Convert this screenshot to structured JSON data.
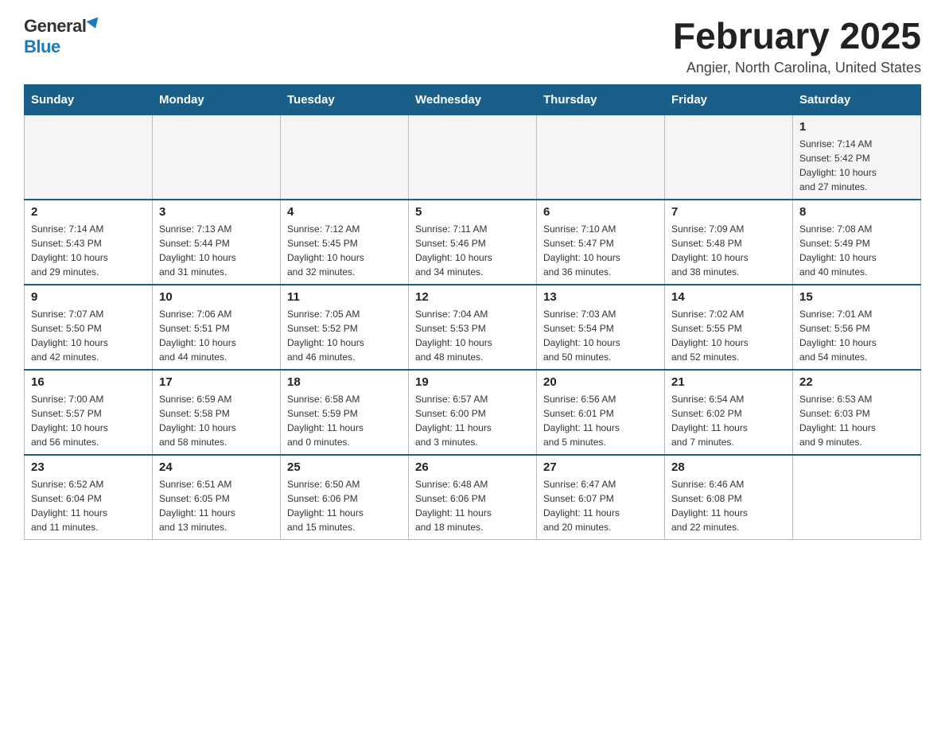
{
  "logo": {
    "general": "General",
    "blue": "Blue"
  },
  "title": "February 2025",
  "subtitle": "Angier, North Carolina, United States",
  "days_of_week": [
    "Sunday",
    "Monday",
    "Tuesday",
    "Wednesday",
    "Thursday",
    "Friday",
    "Saturday"
  ],
  "weeks": [
    {
      "days": [
        {
          "number": "",
          "info": ""
        },
        {
          "number": "",
          "info": ""
        },
        {
          "number": "",
          "info": ""
        },
        {
          "number": "",
          "info": ""
        },
        {
          "number": "",
          "info": ""
        },
        {
          "number": "",
          "info": ""
        },
        {
          "number": "1",
          "info": "Sunrise: 7:14 AM\nSunset: 5:42 PM\nDaylight: 10 hours\nand 27 minutes."
        }
      ]
    },
    {
      "days": [
        {
          "number": "2",
          "info": "Sunrise: 7:14 AM\nSunset: 5:43 PM\nDaylight: 10 hours\nand 29 minutes."
        },
        {
          "number": "3",
          "info": "Sunrise: 7:13 AM\nSunset: 5:44 PM\nDaylight: 10 hours\nand 31 minutes."
        },
        {
          "number": "4",
          "info": "Sunrise: 7:12 AM\nSunset: 5:45 PM\nDaylight: 10 hours\nand 32 minutes."
        },
        {
          "number": "5",
          "info": "Sunrise: 7:11 AM\nSunset: 5:46 PM\nDaylight: 10 hours\nand 34 minutes."
        },
        {
          "number": "6",
          "info": "Sunrise: 7:10 AM\nSunset: 5:47 PM\nDaylight: 10 hours\nand 36 minutes."
        },
        {
          "number": "7",
          "info": "Sunrise: 7:09 AM\nSunset: 5:48 PM\nDaylight: 10 hours\nand 38 minutes."
        },
        {
          "number": "8",
          "info": "Sunrise: 7:08 AM\nSunset: 5:49 PM\nDaylight: 10 hours\nand 40 minutes."
        }
      ]
    },
    {
      "days": [
        {
          "number": "9",
          "info": "Sunrise: 7:07 AM\nSunset: 5:50 PM\nDaylight: 10 hours\nand 42 minutes."
        },
        {
          "number": "10",
          "info": "Sunrise: 7:06 AM\nSunset: 5:51 PM\nDaylight: 10 hours\nand 44 minutes."
        },
        {
          "number": "11",
          "info": "Sunrise: 7:05 AM\nSunset: 5:52 PM\nDaylight: 10 hours\nand 46 minutes."
        },
        {
          "number": "12",
          "info": "Sunrise: 7:04 AM\nSunset: 5:53 PM\nDaylight: 10 hours\nand 48 minutes."
        },
        {
          "number": "13",
          "info": "Sunrise: 7:03 AM\nSunset: 5:54 PM\nDaylight: 10 hours\nand 50 minutes."
        },
        {
          "number": "14",
          "info": "Sunrise: 7:02 AM\nSunset: 5:55 PM\nDaylight: 10 hours\nand 52 minutes."
        },
        {
          "number": "15",
          "info": "Sunrise: 7:01 AM\nSunset: 5:56 PM\nDaylight: 10 hours\nand 54 minutes."
        }
      ]
    },
    {
      "days": [
        {
          "number": "16",
          "info": "Sunrise: 7:00 AM\nSunset: 5:57 PM\nDaylight: 10 hours\nand 56 minutes."
        },
        {
          "number": "17",
          "info": "Sunrise: 6:59 AM\nSunset: 5:58 PM\nDaylight: 10 hours\nand 58 minutes."
        },
        {
          "number": "18",
          "info": "Sunrise: 6:58 AM\nSunset: 5:59 PM\nDaylight: 11 hours\nand 0 minutes."
        },
        {
          "number": "19",
          "info": "Sunrise: 6:57 AM\nSunset: 6:00 PM\nDaylight: 11 hours\nand 3 minutes."
        },
        {
          "number": "20",
          "info": "Sunrise: 6:56 AM\nSunset: 6:01 PM\nDaylight: 11 hours\nand 5 minutes."
        },
        {
          "number": "21",
          "info": "Sunrise: 6:54 AM\nSunset: 6:02 PM\nDaylight: 11 hours\nand 7 minutes."
        },
        {
          "number": "22",
          "info": "Sunrise: 6:53 AM\nSunset: 6:03 PM\nDaylight: 11 hours\nand 9 minutes."
        }
      ]
    },
    {
      "days": [
        {
          "number": "23",
          "info": "Sunrise: 6:52 AM\nSunset: 6:04 PM\nDaylight: 11 hours\nand 11 minutes."
        },
        {
          "number": "24",
          "info": "Sunrise: 6:51 AM\nSunset: 6:05 PM\nDaylight: 11 hours\nand 13 minutes."
        },
        {
          "number": "25",
          "info": "Sunrise: 6:50 AM\nSunset: 6:06 PM\nDaylight: 11 hours\nand 15 minutes."
        },
        {
          "number": "26",
          "info": "Sunrise: 6:48 AM\nSunset: 6:06 PM\nDaylight: 11 hours\nand 18 minutes."
        },
        {
          "number": "27",
          "info": "Sunrise: 6:47 AM\nSunset: 6:07 PM\nDaylight: 11 hours\nand 20 minutes."
        },
        {
          "number": "28",
          "info": "Sunrise: 6:46 AM\nSunset: 6:08 PM\nDaylight: 11 hours\nand 22 minutes."
        },
        {
          "number": "",
          "info": ""
        }
      ]
    }
  ]
}
